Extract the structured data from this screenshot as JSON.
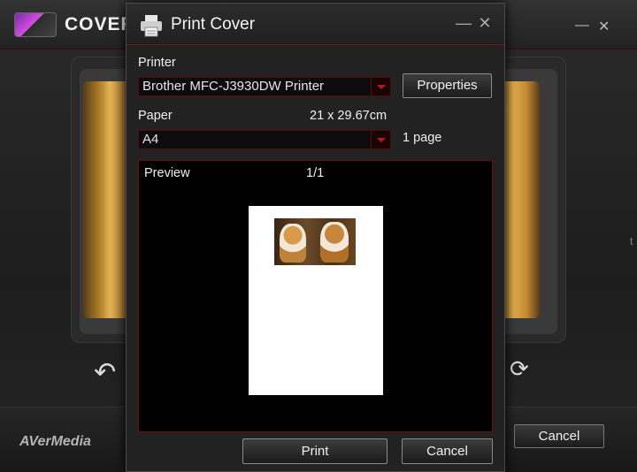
{
  "background_app": {
    "title": "COVER",
    "brand": "AVerMedia",
    "cancel_label": "Cancel",
    "edge_text": "t",
    "minimize_glyph": "—",
    "close_glyph": "✕",
    "undo_icon": "undo-icon",
    "rotate_icon": "rotate-icon"
  },
  "dialog": {
    "title": "Print Cover",
    "minimize_glyph": "—",
    "close_glyph": "✕",
    "printer_label": "Printer",
    "printer_value": "Brother MFC-J3930DW Printer",
    "properties_label": "Properties",
    "paper_label": "Paper",
    "paper_size": "21 x 29.67cm",
    "paper_value": "A4",
    "page_count": "1 page",
    "preview_label": "Preview",
    "preview_page": "1/1",
    "print_label": "Print",
    "cancel_label": "Cancel"
  },
  "colors": {
    "accent_red": "#c01818",
    "dialog_bg": "#222222",
    "preview_bg": "#000000"
  }
}
